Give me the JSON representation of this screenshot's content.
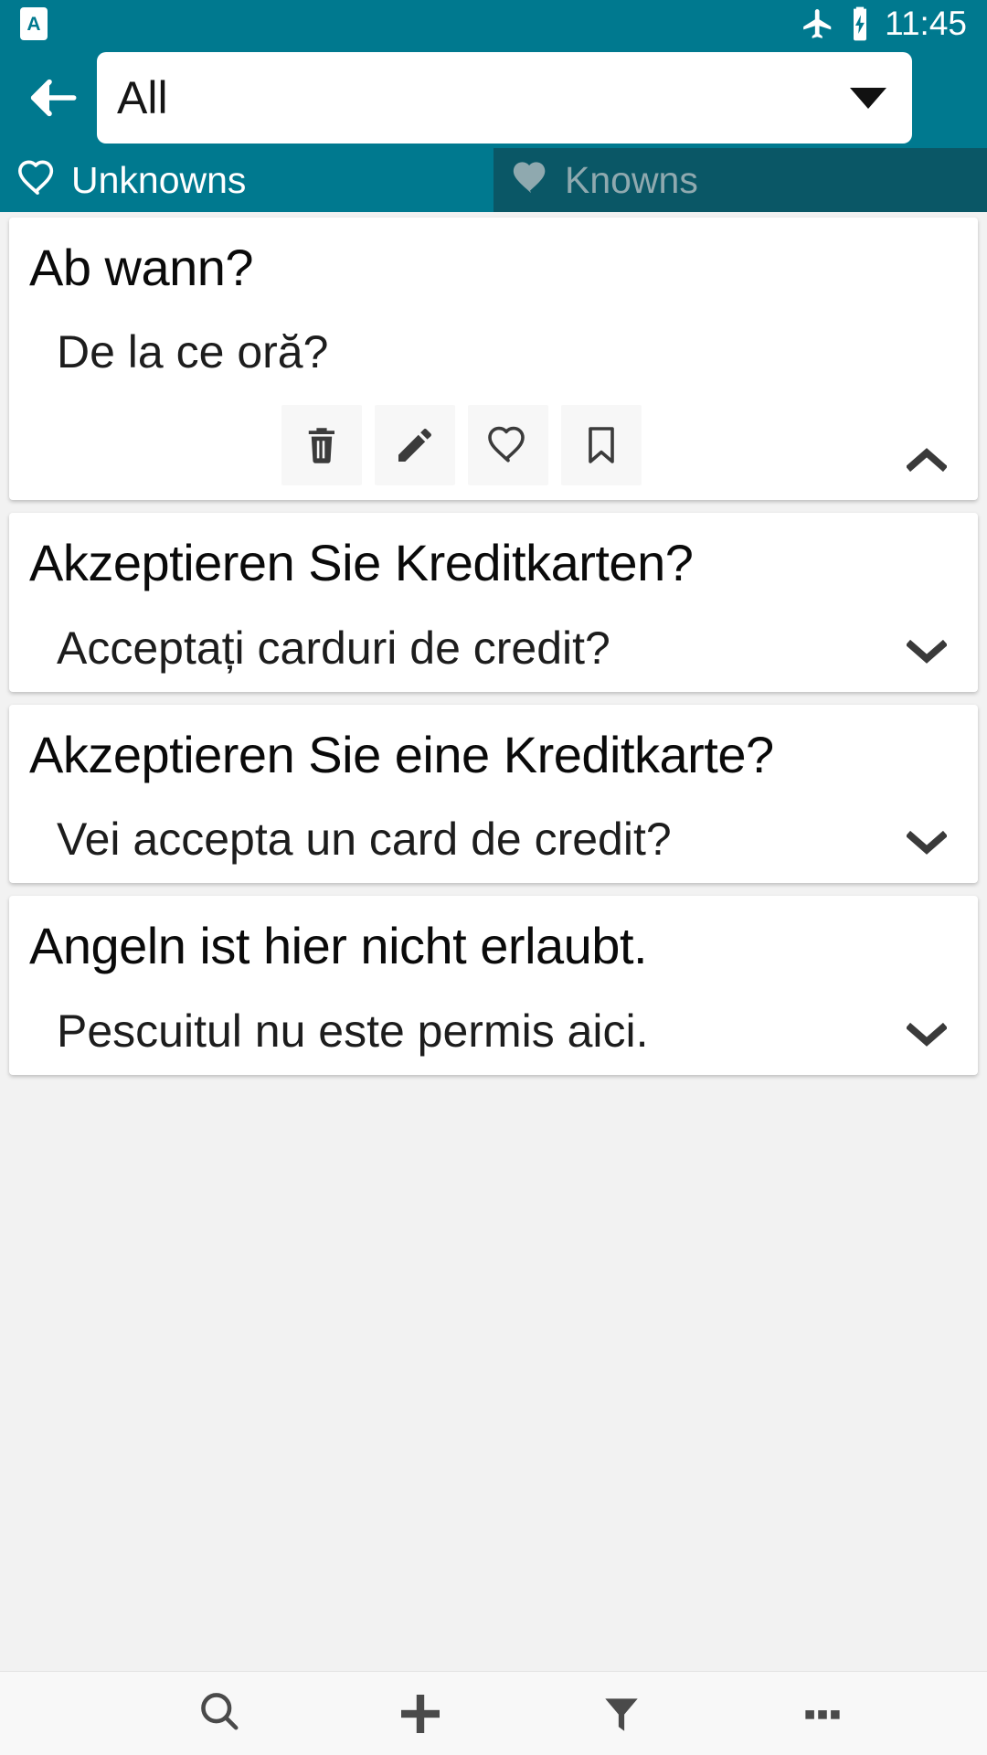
{
  "status_bar": {
    "app_badge_letter": "A",
    "app_badge_icon": "app-notification-icon",
    "airplane_icon": "airplane-mode-icon",
    "battery_icon": "battery-charging-icon",
    "time": "11:45"
  },
  "top_bar": {
    "back_icon": "back-arrow-icon",
    "filter_spinner_value": "All",
    "dropdown_icon": "chevron-down-icon"
  },
  "tabs": [
    {
      "label": "Unknowns",
      "icon": "heart-outline-icon",
      "active": true
    },
    {
      "label": "Knowns",
      "icon": "heart-filled-icon",
      "active": false
    }
  ],
  "cards": [
    {
      "term": "Ab wann?",
      "translation": "De la ce oră?",
      "expanded": true,
      "expander_icon": "chevron-up-icon",
      "actions": [
        {
          "name": "delete-button",
          "icon": "trash-icon"
        },
        {
          "name": "edit-button",
          "icon": "pencil-icon"
        },
        {
          "name": "favorite-button",
          "icon": "heart-outline-icon"
        },
        {
          "name": "bookmark-button",
          "icon": "bookmark-outline-icon"
        }
      ]
    },
    {
      "term": "Akzeptieren Sie Kreditkarten?",
      "translation": "Acceptați carduri de credit?",
      "expanded": false,
      "expander_icon": "chevron-down-icon"
    },
    {
      "term": "Akzeptieren Sie eine Kreditkarte?",
      "translation": "Vei accepta un card de credit?",
      "expanded": false,
      "expander_icon": "chevron-down-icon"
    },
    {
      "term": "Angeln ist hier nicht erlaubt.",
      "translation": "Pescuitul nu este permis aici.",
      "expanded": false,
      "expander_icon": "chevron-down-icon"
    }
  ],
  "bottom_bar": [
    {
      "name": "search-button",
      "icon": "search-icon"
    },
    {
      "name": "add-button",
      "icon": "plus-icon"
    },
    {
      "name": "filter-button",
      "icon": "filter-funnel-icon"
    },
    {
      "name": "more-options-button",
      "icon": "overflow-dots-icon"
    }
  ],
  "colors": {
    "primary_teal": "#00798f",
    "tab_inactive_teal": "#0a5766",
    "page_background": "#f2f2f2",
    "card_background": "#ffffff",
    "icon_dark": "#3b3b3b"
  }
}
